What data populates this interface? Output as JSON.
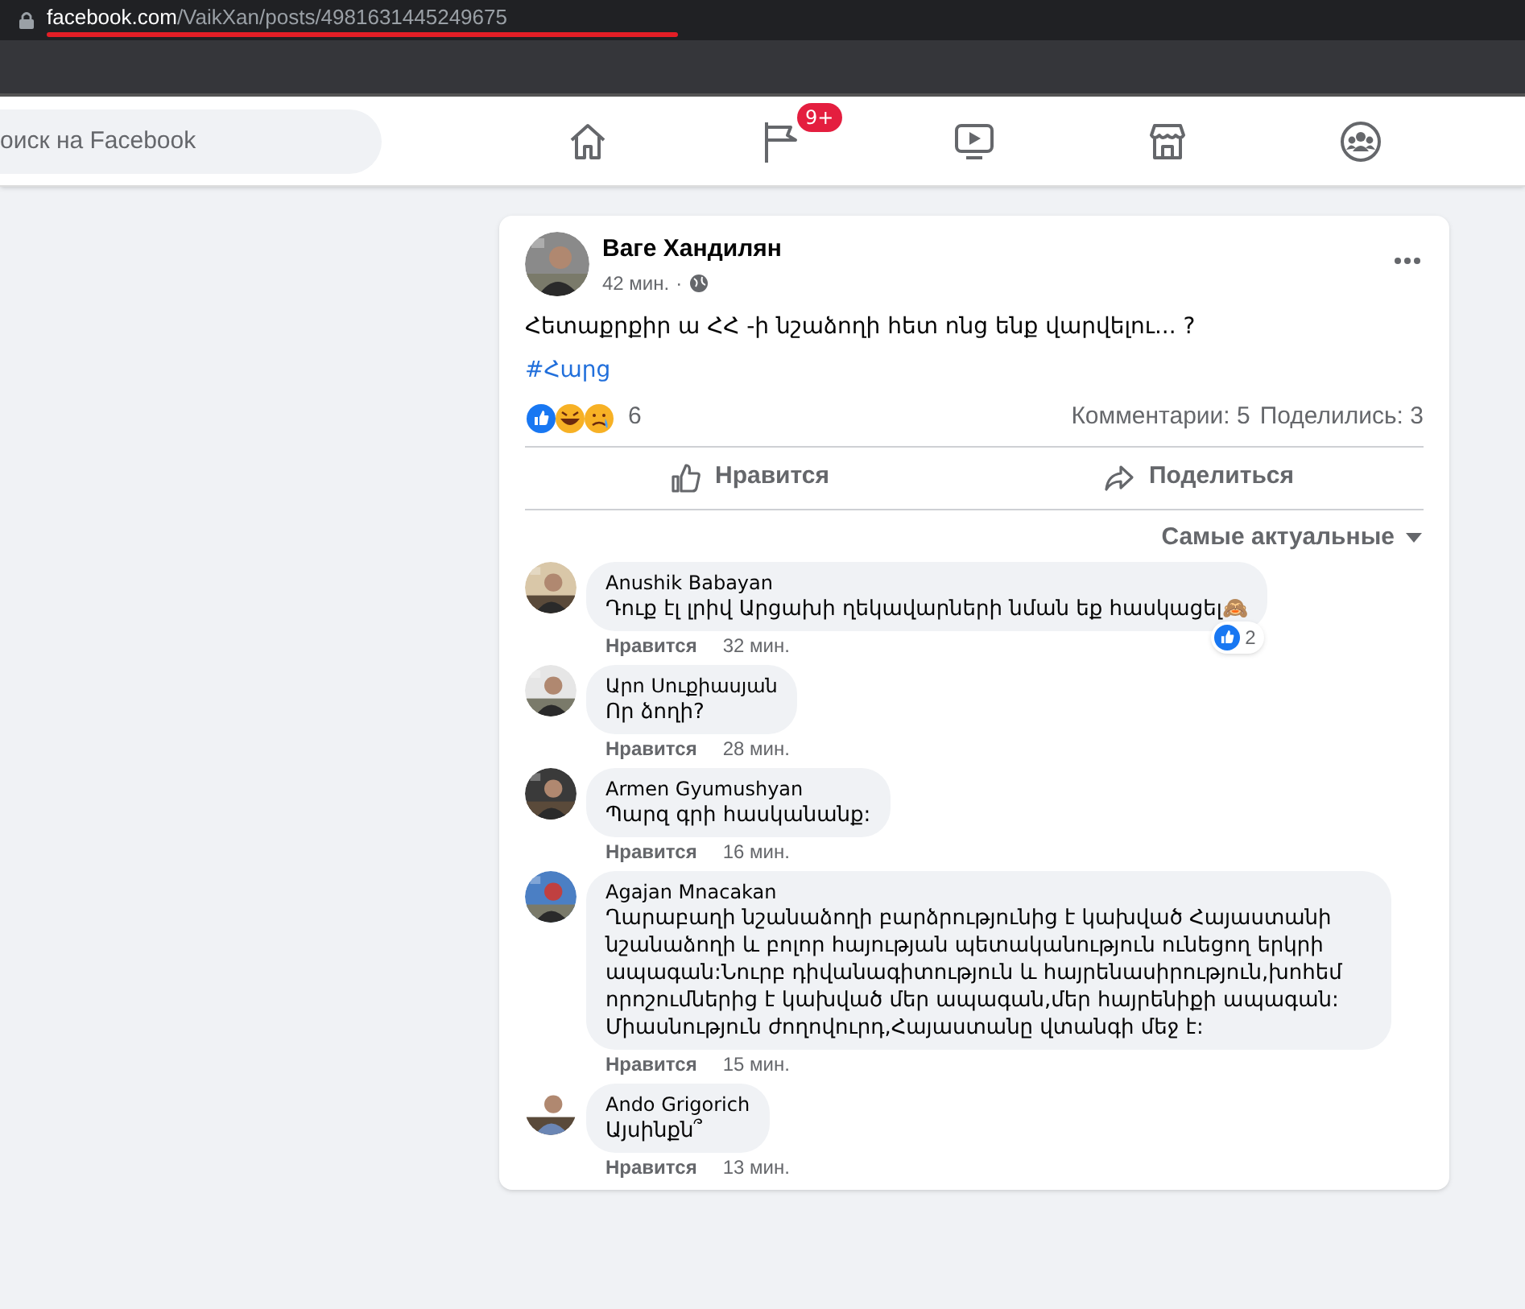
{
  "browser": {
    "url_host": "facebook.com",
    "url_path": "/VaikXan/posts/4981631445249675"
  },
  "navbar": {
    "search": {
      "placeholder": "оиск на Facebook"
    },
    "nav": [
      {
        "kind": "home"
      },
      {
        "kind": "flag",
        "badge": "9+"
      },
      {
        "kind": "video"
      },
      {
        "kind": "store"
      },
      {
        "kind": "groups"
      }
    ]
  },
  "post": {
    "author": "Ваге Хандилян",
    "time": "42 мин.",
    "time_separator": "·",
    "text": "Հետաքրքիր ա ՀՀ -ի նշաձողի հետ ոնց ենք վարվելու... ?",
    "hashtag": "#Հարց",
    "reactions_count": "6",
    "comments_count": "Комментарии: 5",
    "shares_count": "Поделились: 3",
    "actions": [
      {
        "kind": "like",
        "label": "Нравится"
      },
      {
        "kind": "share",
        "label": "Поделиться"
      }
    ],
    "sort": "Самые актуальные"
  },
  "comments": [
    {
      "author": "Anushik Babayan",
      "text": "Դուք էլ լրիվ Արցախի ղեկավարների նման եք հասկացել🙈",
      "like": "Нравится",
      "time": "32 мин.",
      "reaction_count": "2"
    },
    {
      "author": "Արո Սուքիասյան",
      "text": "Որ ձողի?",
      "like": "Нравится",
      "time": "28 мин."
    },
    {
      "author": "Armen Gyumushyan",
      "text": "Պարզ գրի հասկանանք:",
      "like": "Нравится",
      "time": "16 мин."
    },
    {
      "author": "Agajan Mnacakan",
      "text": "Ղարաբաղի նշանաձողի բարձրությունից է կախված Հայաստանի նշանաձողի և բոլոր հայության պետականություն ունեցող երկրի ապագան:Նուրբ դիվանագիտություն և հայրենասիրություն,խոհեմ որոշումներից է կախված մեր ապագան,մեր հայրենիքի ապագան: Միասնություն ժողովուրդ,Հայաստանը վտանգի մեջ է:",
      "like": "Нравится",
      "time": "15 мин."
    },
    {
      "author": "Ando Grigorich",
      "text": "Այսինքն՞",
      "like": "Нравится",
      "time": "13 мин."
    }
  ]
}
